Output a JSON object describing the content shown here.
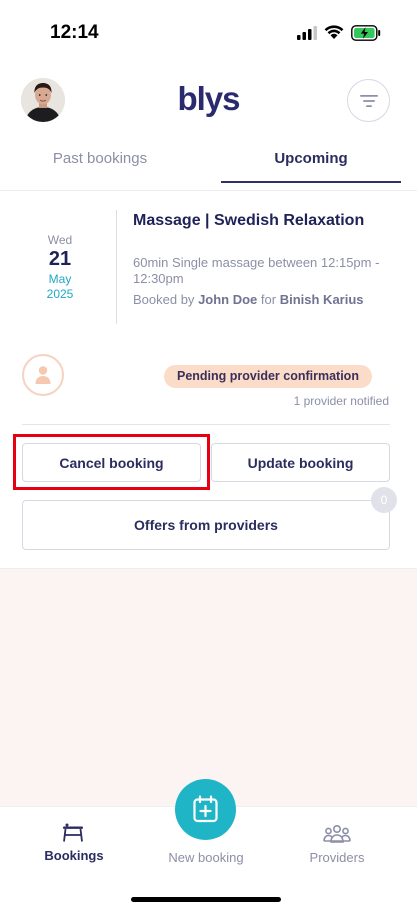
{
  "status_bar": {
    "time": "12:14"
  },
  "header": {
    "logo": "blys"
  },
  "tabs": [
    {
      "label": "Past bookings",
      "active": false
    },
    {
      "label": "Upcoming",
      "active": true
    }
  ],
  "booking": {
    "date": {
      "weekday": "Wed",
      "day": "21",
      "month": "May",
      "year": "2025"
    },
    "title": "Massage | Swedish Relaxation",
    "description": "60min Single massage between 12:15pm - 12:30pm",
    "booked_by_prefix": "Booked by",
    "booked_by_name": "John Doe",
    "for_word": "for",
    "recipient": "Binish Karius",
    "status": "Pending provider confirmation",
    "providers_notified": "1 provider notified",
    "actions": {
      "cancel": "Cancel booking",
      "update": "Update booking",
      "offers": "Offers from providers",
      "offers_count": "0"
    }
  },
  "bottom_nav": {
    "bookings": "Bookings",
    "new_booking": "New booking",
    "providers": "Providers"
  },
  "colors": {
    "accent": "#1fb5c6",
    "brand": "#2c2a6e",
    "pending_badge": "#fbdcc9",
    "highlight": "#e60012"
  }
}
